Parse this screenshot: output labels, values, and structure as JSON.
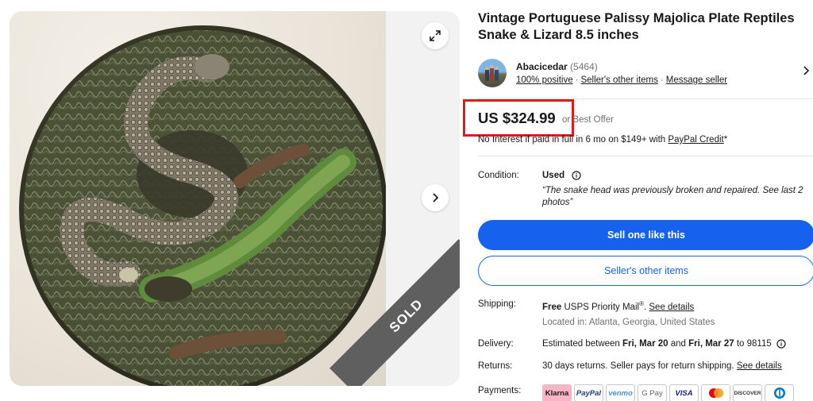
{
  "gallery": {
    "sold_label": "SOLD",
    "expand_icon": "expand-icon",
    "next_icon": "chevron-right-icon"
  },
  "listing": {
    "title": "Vintage Portuguese Palissy Majolica Plate Reptiles Snake & Lizard 8.5 inches"
  },
  "seller": {
    "name": "Abacicedar",
    "feedback_count": "(5464)",
    "positive": "100% positive",
    "other_items_link": "Seller's other items",
    "message_link": "Message seller"
  },
  "price": {
    "amount": "US $324.99",
    "best_offer": "or Best Offer",
    "credit_prefix": "No Interest if paid in full in 6 mo on $149+ with ",
    "credit_link": "PayPal Credit",
    "credit_suffix": "*",
    "highlight_color": "#e0191b"
  },
  "condition": {
    "label": "Condition:",
    "value": "Used",
    "note": "“The snake head was previously broken and repaired. See last 2 photos”"
  },
  "buttons": {
    "primary": "Sell one like this",
    "secondary": "Seller's other items",
    "accent_color": "#1662ee"
  },
  "shipping": {
    "label": "Shipping:",
    "free": "Free",
    "service": " USPS Priority Mail",
    "reg": "®",
    "dot": ". ",
    "details_link": "See details",
    "location": "Located in: Atlanta, Georgia, United States"
  },
  "delivery": {
    "label": "Delivery:",
    "prefix": "Estimated between ",
    "date1": "Fri, Mar 20",
    "and": " and ",
    "date2": "Fri, Mar 27",
    "suffix": " to 98115"
  },
  "returns": {
    "label": "Returns:",
    "text": "30 days returns. Seller pays for return shipping. ",
    "details_link": "See details"
  },
  "payments": {
    "label": "Payments:",
    "methods": [
      "Klarna",
      "PayPal",
      "venmo",
      "G Pay",
      "VISA",
      "Mastercard",
      "DISCOVER",
      "Diners"
    ]
  }
}
